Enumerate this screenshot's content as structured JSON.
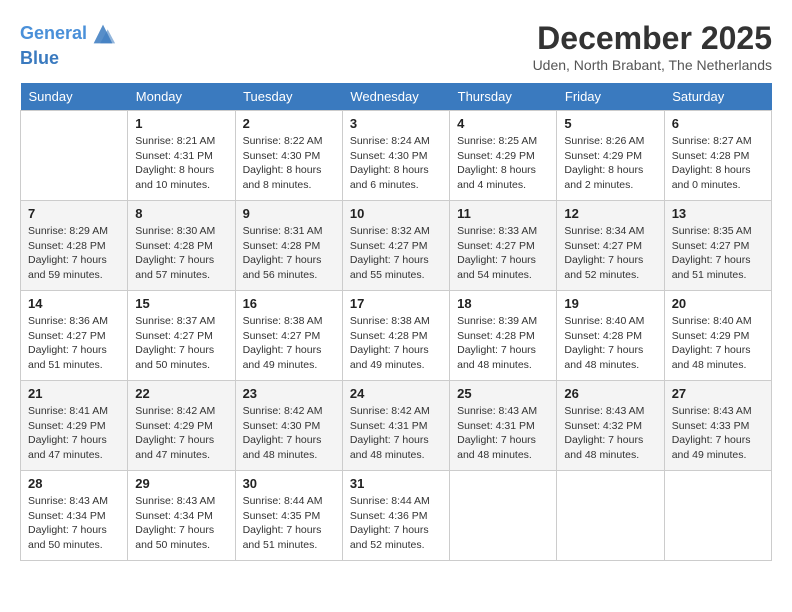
{
  "header": {
    "logo_line1": "General",
    "logo_line2": "Blue",
    "month_title": "December 2025",
    "location": "Uden, North Brabant, The Netherlands"
  },
  "days_of_week": [
    "Sunday",
    "Monday",
    "Tuesday",
    "Wednesday",
    "Thursday",
    "Friday",
    "Saturday"
  ],
  "weeks": [
    [
      {
        "num": "",
        "sunrise": "",
        "sunset": "",
        "daylight": ""
      },
      {
        "num": "1",
        "sunrise": "Sunrise: 8:21 AM",
        "sunset": "Sunset: 4:31 PM",
        "daylight": "Daylight: 8 hours and 10 minutes."
      },
      {
        "num": "2",
        "sunrise": "Sunrise: 8:22 AM",
        "sunset": "Sunset: 4:30 PM",
        "daylight": "Daylight: 8 hours and 8 minutes."
      },
      {
        "num": "3",
        "sunrise": "Sunrise: 8:24 AM",
        "sunset": "Sunset: 4:30 PM",
        "daylight": "Daylight: 8 hours and 6 minutes."
      },
      {
        "num": "4",
        "sunrise": "Sunrise: 8:25 AM",
        "sunset": "Sunset: 4:29 PM",
        "daylight": "Daylight: 8 hours and 4 minutes."
      },
      {
        "num": "5",
        "sunrise": "Sunrise: 8:26 AM",
        "sunset": "Sunset: 4:29 PM",
        "daylight": "Daylight: 8 hours and 2 minutes."
      },
      {
        "num": "6",
        "sunrise": "Sunrise: 8:27 AM",
        "sunset": "Sunset: 4:28 PM",
        "daylight": "Daylight: 8 hours and 0 minutes."
      }
    ],
    [
      {
        "num": "7",
        "sunrise": "Sunrise: 8:29 AM",
        "sunset": "Sunset: 4:28 PM",
        "daylight": "Daylight: 7 hours and 59 minutes."
      },
      {
        "num": "8",
        "sunrise": "Sunrise: 8:30 AM",
        "sunset": "Sunset: 4:28 PM",
        "daylight": "Daylight: 7 hours and 57 minutes."
      },
      {
        "num": "9",
        "sunrise": "Sunrise: 8:31 AM",
        "sunset": "Sunset: 4:28 PM",
        "daylight": "Daylight: 7 hours and 56 minutes."
      },
      {
        "num": "10",
        "sunrise": "Sunrise: 8:32 AM",
        "sunset": "Sunset: 4:27 PM",
        "daylight": "Daylight: 7 hours and 55 minutes."
      },
      {
        "num": "11",
        "sunrise": "Sunrise: 8:33 AM",
        "sunset": "Sunset: 4:27 PM",
        "daylight": "Daylight: 7 hours and 54 minutes."
      },
      {
        "num": "12",
        "sunrise": "Sunrise: 8:34 AM",
        "sunset": "Sunset: 4:27 PM",
        "daylight": "Daylight: 7 hours and 52 minutes."
      },
      {
        "num": "13",
        "sunrise": "Sunrise: 8:35 AM",
        "sunset": "Sunset: 4:27 PM",
        "daylight": "Daylight: 7 hours and 51 minutes."
      }
    ],
    [
      {
        "num": "14",
        "sunrise": "Sunrise: 8:36 AM",
        "sunset": "Sunset: 4:27 PM",
        "daylight": "Daylight: 7 hours and 51 minutes."
      },
      {
        "num": "15",
        "sunrise": "Sunrise: 8:37 AM",
        "sunset": "Sunset: 4:27 PM",
        "daylight": "Daylight: 7 hours and 50 minutes."
      },
      {
        "num": "16",
        "sunrise": "Sunrise: 8:38 AM",
        "sunset": "Sunset: 4:27 PM",
        "daylight": "Daylight: 7 hours and 49 minutes."
      },
      {
        "num": "17",
        "sunrise": "Sunrise: 8:38 AM",
        "sunset": "Sunset: 4:28 PM",
        "daylight": "Daylight: 7 hours and 49 minutes."
      },
      {
        "num": "18",
        "sunrise": "Sunrise: 8:39 AM",
        "sunset": "Sunset: 4:28 PM",
        "daylight": "Daylight: 7 hours and 48 minutes."
      },
      {
        "num": "19",
        "sunrise": "Sunrise: 8:40 AM",
        "sunset": "Sunset: 4:28 PM",
        "daylight": "Daylight: 7 hours and 48 minutes."
      },
      {
        "num": "20",
        "sunrise": "Sunrise: 8:40 AM",
        "sunset": "Sunset: 4:29 PM",
        "daylight": "Daylight: 7 hours and 48 minutes."
      }
    ],
    [
      {
        "num": "21",
        "sunrise": "Sunrise: 8:41 AM",
        "sunset": "Sunset: 4:29 PM",
        "daylight": "Daylight: 7 hours and 47 minutes."
      },
      {
        "num": "22",
        "sunrise": "Sunrise: 8:42 AM",
        "sunset": "Sunset: 4:29 PM",
        "daylight": "Daylight: 7 hours and 47 minutes."
      },
      {
        "num": "23",
        "sunrise": "Sunrise: 8:42 AM",
        "sunset": "Sunset: 4:30 PM",
        "daylight": "Daylight: 7 hours and 48 minutes."
      },
      {
        "num": "24",
        "sunrise": "Sunrise: 8:42 AM",
        "sunset": "Sunset: 4:31 PM",
        "daylight": "Daylight: 7 hours and 48 minutes."
      },
      {
        "num": "25",
        "sunrise": "Sunrise: 8:43 AM",
        "sunset": "Sunset: 4:31 PM",
        "daylight": "Daylight: 7 hours and 48 minutes."
      },
      {
        "num": "26",
        "sunrise": "Sunrise: 8:43 AM",
        "sunset": "Sunset: 4:32 PM",
        "daylight": "Daylight: 7 hours and 48 minutes."
      },
      {
        "num": "27",
        "sunrise": "Sunrise: 8:43 AM",
        "sunset": "Sunset: 4:33 PM",
        "daylight": "Daylight: 7 hours and 49 minutes."
      }
    ],
    [
      {
        "num": "28",
        "sunrise": "Sunrise: 8:43 AM",
        "sunset": "Sunset: 4:34 PM",
        "daylight": "Daylight: 7 hours and 50 minutes."
      },
      {
        "num": "29",
        "sunrise": "Sunrise: 8:43 AM",
        "sunset": "Sunset: 4:34 PM",
        "daylight": "Daylight: 7 hours and 50 minutes."
      },
      {
        "num": "30",
        "sunrise": "Sunrise: 8:44 AM",
        "sunset": "Sunset: 4:35 PM",
        "daylight": "Daylight: 7 hours and 51 minutes."
      },
      {
        "num": "31",
        "sunrise": "Sunrise: 8:44 AM",
        "sunset": "Sunset: 4:36 PM",
        "daylight": "Daylight: 7 hours and 52 minutes."
      },
      {
        "num": "",
        "sunrise": "",
        "sunset": "",
        "daylight": ""
      },
      {
        "num": "",
        "sunrise": "",
        "sunset": "",
        "daylight": ""
      },
      {
        "num": "",
        "sunrise": "",
        "sunset": "",
        "daylight": ""
      }
    ]
  ]
}
